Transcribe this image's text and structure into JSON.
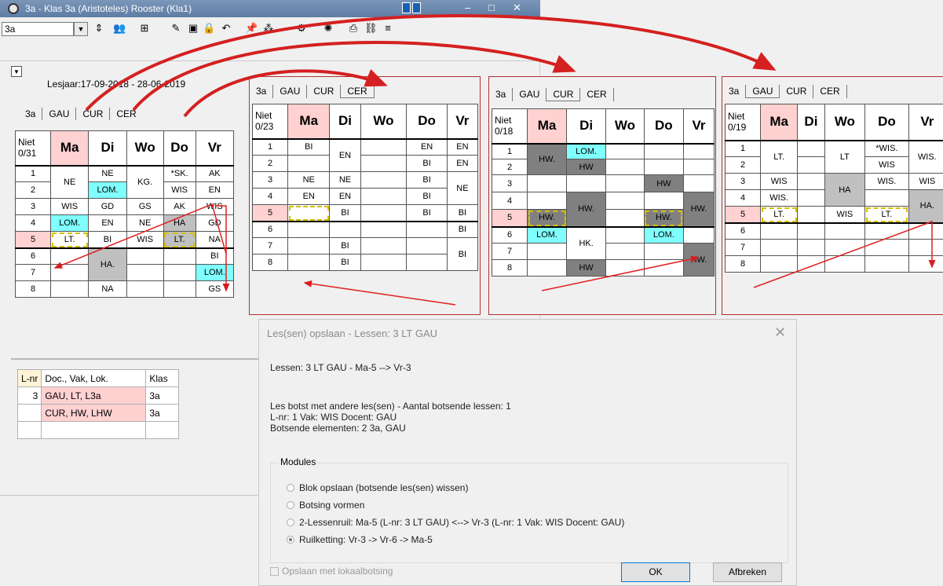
{
  "window": {
    "title": "3a - Klas 3a (Aristoteles) Rooster (Kla1)",
    "combo_value": "3a",
    "schoolyear": "Lesjaar:17-09-2018 - 28-06-2019",
    "tabs": [
      "3a",
      "GAU",
      "CUR",
      "CER"
    ]
  },
  "days": [
    "Ma",
    "Di",
    "Wo",
    "Do",
    "Vr"
  ],
  "periods": [
    "1",
    "2",
    "3",
    "4",
    "5",
    "6",
    "7",
    "8"
  ],
  "main_grid": {
    "niet": "Niet",
    "count": "0/31",
    "cells": {
      "ne_ma": "NE",
      "ne_di": "NE",
      "kg_wo": "KG.",
      "sk_do": "*SK.",
      "ak_vr": "AK",
      "lom_di": "LOM.",
      "wis_do2": "WIS",
      "en_vr2": "EN",
      "wis_ma3": "WIS",
      "gd_di3": "GD",
      "gs_wo3": "GS",
      "ak_do3": "AK",
      "wis_vr3": "WIS",
      "lom_ma4": "LOM.",
      "en_di4": "EN",
      "ne_wo4": "NE",
      "ha_do4": "HA",
      "gd_vr4": "GD",
      "lt_ma5": "LT.",
      "bi_di5": "BI",
      "wis_wo5": "WIS",
      "lt_do5": "LT.",
      "na_vr5": "NA",
      "ha_di6": "HA.",
      "bi_vr6": "BI",
      "lom_vr7": "LOM.",
      "na_di8": "NA",
      "gs_vr8": "GS"
    }
  },
  "panel_cer": {
    "tabs": [
      "3a",
      "GAU",
      "CUR",
      "CER"
    ],
    "niet": "Niet",
    "count": "0/23",
    "cells": {
      "bi_ma1": "BI",
      "en_di1": "EN",
      "en_do1": "EN",
      "en_vr1": "EN",
      "bi_do2": "BI",
      "en_vr2": "EN",
      "ne_ma3": "NE",
      "ne_di3": "NE",
      "bi_do3": "BI",
      "ne_vr3": "NE",
      "en_ma4": "EN",
      "en_di4": "EN",
      "bi_do4": "BI",
      "bi_di5": "BI",
      "bi_do5": "BI",
      "bi_vr5": "BI",
      "bi_vr6": "BI",
      "bi_di7": "BI",
      "bi_vr7": "BI",
      "bi_di8": "BI"
    }
  },
  "panel_cur": {
    "tabs": [
      "3a",
      "GAU",
      "CUR",
      "CER"
    ],
    "niet": "Niet",
    "count": "0/18",
    "cells": {
      "hw_ma1": "HW.",
      "lom_di1": "LOM.",
      "hw_di2": "HW",
      "hw_do3": "HW",
      "hw_di4": "HW.",
      "hw_vr4": "HW.",
      "hw_ma5": "HW.",
      "hw_do5": "HW.",
      "lom_ma6": "LOM.",
      "hk_di6": "HK.",
      "lom_do6": "LOM.",
      "hw_vr7": "HW.",
      "hw_di8": "HW"
    }
  },
  "panel_gau": {
    "tabs": [
      "3a",
      "GAU",
      "CUR",
      "CER"
    ],
    "niet": "Niet",
    "count": "0/19",
    "cells": {
      "lt_ma1": "LT.",
      "lt_wo1": "LT",
      "wis_do1": "*WIS.",
      "wis_vr1": "WIS.",
      "wis_do2": "WIS",
      "wis_ma3": "WIS",
      "ha_wo3": "HA",
      "wis_do3": "WIS.",
      "wis_vr3": "WIS",
      "wis_ma4": "WIS.",
      "ha_vr4": "HA.",
      "lt_ma5": "LT.",
      "wis_wo5": "WIS",
      "lt_do5": "LT."
    }
  },
  "lesson_list": {
    "headers": [
      "L-nr",
      "Doc., Vak, Lok.",
      "Klas"
    ],
    "rows": [
      {
        "nr": "3",
        "dvl": "GAU, LT, L3a",
        "klas": "3a"
      },
      {
        "nr": "",
        "dvl": "CUR, HW, LHW",
        "klas": "3a"
      }
    ]
  },
  "dialog": {
    "title": "Les(sen) opslaan - Lessen: 3 LT GAU",
    "lessen": "Lessen: 3 LT GAU - Ma-5 --> Vr-3",
    "conflict1": "Les botst met andere les(sen) - Aantal botsende lessen: 1",
    "conflict2": "L-nr: 1 Vak: WIS Docent: GAU",
    "conflict3": "Botsende elementen: 2 3a, GAU",
    "modules_label": "Modules",
    "options": [
      "Blok opslaan (botsende les(sen) wissen)",
      "Botsing vormen",
      "2-Lessenruil: Ma-5 (L-nr: 3 LT GAU) <--> Vr-3 (L-nr: 1 Vak: WIS Docent: GAU)",
      "Ruilketting: Vr-3 -> Vr-6 -> Ma-5"
    ],
    "checkbox": "Opslaan met lokaalbotsing",
    "ok": "OK",
    "cancel": "Afbreken"
  },
  "colors": {
    "pink": "#ffd1d1",
    "cyan": "#80ffff",
    "gray": "#c0c0c0",
    "dark": "#808080",
    "arrow": "#d42020"
  }
}
